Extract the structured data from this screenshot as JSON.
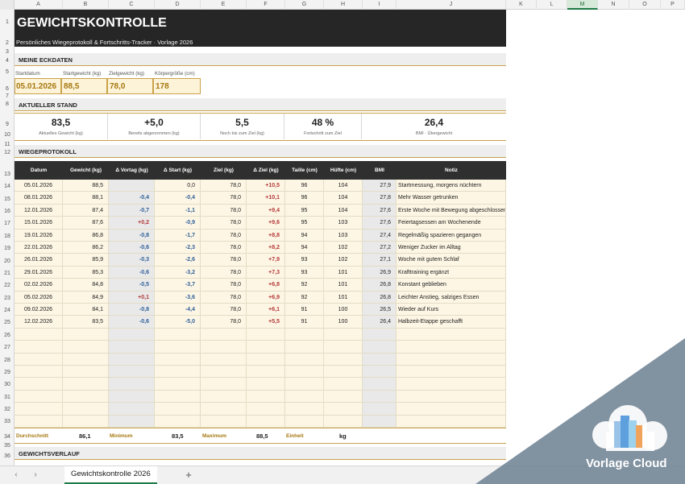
{
  "columns": [
    "A",
    "B",
    "C",
    "D",
    "E",
    "F",
    "G",
    "H",
    "I",
    "J",
    "K",
    "L",
    "M",
    "N",
    "O",
    "P"
  ],
  "selected_column": "M",
  "rows": [
    "1",
    "2",
    "3",
    "4",
    "5",
    "6",
    "7",
    "8",
    "9",
    "10",
    "11",
    "12",
    "13",
    "14",
    "15",
    "16",
    "17",
    "18",
    "19",
    "20",
    "21",
    "22",
    "23",
    "24",
    "25",
    "26",
    "27",
    "28",
    "29",
    "30",
    "31",
    "32",
    "33",
    "34",
    "35",
    "36"
  ],
  "title": "GEWICHTSKONTROLLE",
  "subtitle": "Persönliches Wiegeprotokoll & Fortschritts-Tracker  ·  Vorlage 2026",
  "eckdaten": {
    "section": "MEINE ECKDATEN",
    "labels": [
      "Startdatum",
      "Startgewicht (kg)",
      "Zielgewicht (kg)",
      "Körpergröße (cm)"
    ],
    "values": [
      "05.01.2026",
      "88,5",
      "78,0",
      "178"
    ]
  },
  "stand": {
    "section": "AKTUELLER STAND",
    "stats": [
      {
        "value": "83,5",
        "label": "Aktuelles Gewicht (kg)"
      },
      {
        "value": "+5,0",
        "label": "Bereits abgenommen (kg)"
      },
      {
        "value": "5,5",
        "label": "Noch bis zum Ziel (kg)"
      },
      {
        "value": "48 %",
        "label": "Fortschritt zum Ziel"
      },
      {
        "value": "26,4",
        "label": "BMI · Übergewicht"
      }
    ]
  },
  "protokoll": {
    "section": "WIEGEPROTOKOLL",
    "headers": [
      "Datum",
      "Gewicht (kg)",
      "Δ Vortag (kg)",
      "Δ Start (kg)",
      "Ziel (kg)",
      "Δ Ziel (kg)",
      "Taille (cm)",
      "Hüfte (cm)",
      "BMI",
      "Notiz"
    ],
    "entries": [
      [
        "05.01.2026",
        "88,5",
        "",
        "0,0",
        "78,0",
        "+10,5",
        "96",
        "104",
        "27,9",
        "Startmessung, morgens nüchtern"
      ],
      [
        "08.01.2026",
        "88,1",
        "-0,4",
        "-0,4",
        "78,0",
        "+10,1",
        "96",
        "104",
        "27,8",
        "Mehr Wasser getrunken"
      ],
      [
        "12.01.2026",
        "87,4",
        "-0,7",
        "-1,1",
        "78,0",
        "+9,4",
        "95",
        "104",
        "27,6",
        "Erste Woche mit Bewegung abgeschlossen"
      ],
      [
        "15.01.2026",
        "87,6",
        "+0,2",
        "-0,9",
        "78,0",
        "+9,6",
        "95",
        "103",
        "27,6",
        "Feiertagsessen am Wochenende"
      ],
      [
        "19.01.2026",
        "86,8",
        "-0,8",
        "-1,7",
        "78,0",
        "+8,8",
        "94",
        "103",
        "27,4",
        "Regelmäßig spazieren gegangen"
      ],
      [
        "22.01.2026",
        "86,2",
        "-0,6",
        "-2,3",
        "78,0",
        "+8,2",
        "94",
        "102",
        "27,2",
        "Weniger Zucker im Alltag"
      ],
      [
        "26.01.2026",
        "85,9",
        "-0,3",
        "-2,6",
        "78,0",
        "+7,9",
        "93",
        "102",
        "27,1",
        "Woche mit gutem Schlaf"
      ],
      [
        "29.01.2026",
        "85,3",
        "-0,6",
        "-3,2",
        "78,0",
        "+7,3",
        "93",
        "101",
        "26,9",
        "Krafttraining ergänzt"
      ],
      [
        "02.02.2026",
        "84,8",
        "-0,5",
        "-3,7",
        "78,0",
        "+6,8",
        "92",
        "101",
        "26,8",
        "Konstant geblieben"
      ],
      [
        "05.02.2026",
        "84,9",
        "+0,1",
        "-3,6",
        "78,0",
        "+6,9",
        "92",
        "101",
        "26,8",
        "Leichter Anstieg, salziges Essen"
      ],
      [
        "09.02.2026",
        "84,1",
        "-0,8",
        "-4,4",
        "78,0",
        "+6,1",
        "91",
        "100",
        "26,5",
        "Wieder auf Kurs"
      ],
      [
        "12.02.2026",
        "83,5",
        "-0,6",
        "-5,0",
        "78,0",
        "+5,5",
        "91",
        "100",
        "26,4",
        "Halbzeit-Etappe geschafft"
      ]
    ],
    "empty_rows": 8
  },
  "summary": {
    "avg_label": "Durchschnitt",
    "avg_value": "86,1",
    "min_label": "Minimum",
    "min_value": "83,5",
    "max_label": "Maximum",
    "max_value": "88,5",
    "unit_label": "Einheit",
    "unit_value": "kg"
  },
  "verlauf_section": "GEWICHTSVERLAUF",
  "sheet_tab": "Gewichtskontrolle 2026",
  "watermark": "Vorlage Cloud",
  "colors": {
    "accent": "#c9a34e",
    "header_dark": "#262626",
    "negative": "#2e5f99",
    "positive": "#b33a3a",
    "cream": "#fdf6e4"
  }
}
